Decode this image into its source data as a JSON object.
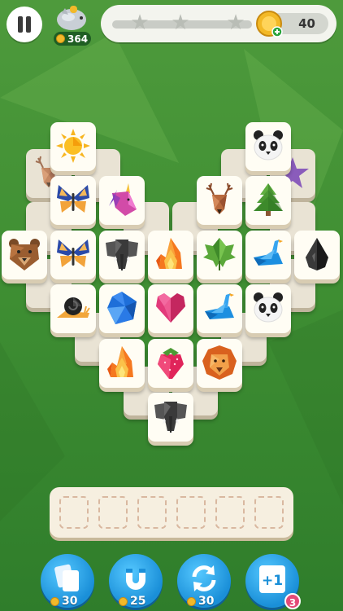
{
  "top_bar": {
    "piggy_coins": "364",
    "coins": "40",
    "stars_total": 3
  },
  "board": {
    "tiles": [
      {
        "id": "deer",
        "layer": "under"
      },
      {
        "id": "star",
        "layer": "under"
      },
      {
        "id": "unicorn-small",
        "layer": "under"
      },
      {
        "id": "sun"
      },
      {
        "id": "panda"
      },
      {
        "id": "butterfly"
      },
      {
        "id": "unicorn"
      },
      {
        "id": "deer"
      },
      {
        "id": "pine"
      },
      {
        "id": "bear"
      },
      {
        "id": "butterfly"
      },
      {
        "id": "elephant"
      },
      {
        "id": "flame"
      },
      {
        "id": "maple-leaf"
      },
      {
        "id": "swan"
      },
      {
        "id": "drop"
      },
      {
        "id": "snail"
      },
      {
        "id": "gem"
      },
      {
        "id": "heart"
      },
      {
        "id": "swan"
      },
      {
        "id": "panda"
      },
      {
        "id": "flame"
      },
      {
        "id": "strawberry"
      },
      {
        "id": "lion"
      },
      {
        "id": "elephant"
      }
    ]
  },
  "tray": {
    "slots": 6
  },
  "powerups": [
    {
      "name": "shuffle-cards",
      "cost": "30"
    },
    {
      "name": "magnet",
      "cost": "25"
    },
    {
      "name": "refresh",
      "cost": "30"
    },
    {
      "name": "plus-one",
      "badge": "3"
    }
  ]
}
